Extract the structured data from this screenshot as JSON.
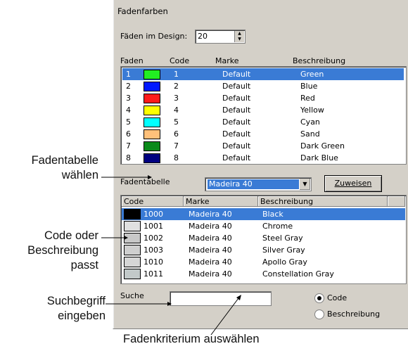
{
  "dialog": {
    "title": "Fadenfarben",
    "threads_in_design_label": "Fäden im Design:",
    "threads_in_design_value": "20",
    "design_columns": [
      "Faden",
      "Code",
      "Marke",
      "Beschreibung"
    ],
    "design_rows": [
      {
        "num": "1",
        "color": "#22ee22",
        "code": "1",
        "brand": "Default",
        "desc": "Green",
        "selected": true
      },
      {
        "num": "2",
        "color": "#0018ff",
        "code": "2",
        "brand": "Default",
        "desc": "Blue"
      },
      {
        "num": "3",
        "color": "#ff1a1a",
        "code": "3",
        "brand": "Default",
        "desc": "Red"
      },
      {
        "num": "4",
        "color": "#ffff00",
        "code": "4",
        "brand": "Default",
        "desc": "Yellow"
      },
      {
        "num": "5",
        "color": "#00ffff",
        "code": "5",
        "brand": "Default",
        "desc": "Cyan"
      },
      {
        "num": "6",
        "color": "#ffc07a",
        "code": "6",
        "brand": "Default",
        "desc": "Sand"
      },
      {
        "num": "7",
        "color": "#0a8a1a",
        "code": "7",
        "brand": "Default",
        "desc": "Dark Green"
      },
      {
        "num": "8",
        "color": "#000080",
        "code": "8",
        "brand": "Default",
        "desc": "Dark Blue"
      }
    ],
    "thread_table_label": "Fadentabelle",
    "thread_table_value": "Madeira 40",
    "assign_button": "Zuweisen",
    "table_columns": [
      "Code",
      "Marke",
      "Beschreibung"
    ],
    "table_rows": [
      {
        "color": "#000000",
        "code": "1000",
        "brand": "Madeira 40",
        "desc": "Black",
        "selected": true
      },
      {
        "color": "#e0e0e0",
        "code": "1001",
        "brand": "Madeira 40",
        "desc": "Chrome"
      },
      {
        "color": "#c8c8c8",
        "code": "1002",
        "brand": "Madeira 40",
        "desc": "Steel Gray"
      },
      {
        "color": "#cfcfcf",
        "code": "1003",
        "brand": "Madeira 40",
        "desc": "Silver Gray"
      },
      {
        "color": "#d6d6d6",
        "code": "1010",
        "brand": "Madeira 40",
        "desc": "Apollo Gray"
      },
      {
        "color": "#c2c9c9",
        "code": "1011",
        "brand": "Madeira 40",
        "desc": "Constellation Gray"
      }
    ],
    "search_label": "Suche",
    "search_value": "",
    "radio_code": "Code",
    "radio_description": "Beschreibung"
  },
  "callouts": {
    "choose_table_line1": "Fadentabelle",
    "choose_table_line2": "wählen",
    "match_line1": "Code oder",
    "match_line2": "Beschreibung",
    "match_line3": "passt",
    "search_line1": "Suchbegriff",
    "search_line2": "eingeben",
    "criteria": "Fadenkriterium auswählen"
  }
}
